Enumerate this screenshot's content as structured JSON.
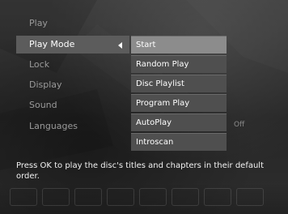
{
  "menu": {
    "items": [
      {
        "label": "Play",
        "active": false
      },
      {
        "label": "Play Mode",
        "active": true
      },
      {
        "label": "Lock",
        "active": false
      },
      {
        "label": "Display",
        "active": false
      },
      {
        "label": "Sound",
        "active": false
      },
      {
        "label": "Languages",
        "active": false
      }
    ]
  },
  "submenu": {
    "items": [
      {
        "label": "Start",
        "selected": true
      },
      {
        "label": "Random Play",
        "selected": false
      },
      {
        "label": "Disc Playlist",
        "selected": false
      },
      {
        "label": "Program Play",
        "selected": false
      },
      {
        "label": "AutoPlay",
        "selected": false
      },
      {
        "label": "Introscan",
        "selected": false
      }
    ],
    "autoplay_value": "Off"
  },
  "help": {
    "text": "Press OK to play the disc's titles and chapters in their default order."
  },
  "icons": {
    "submenu_arrow": "left-arrow-icon"
  }
}
